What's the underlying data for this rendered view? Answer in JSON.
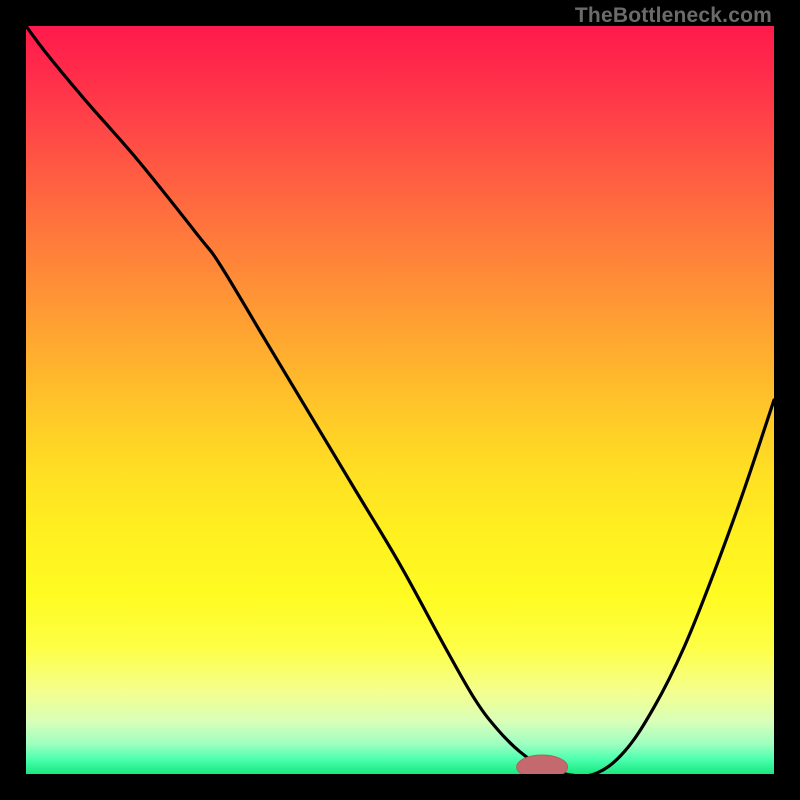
{
  "watermark": "TheBottleneck.com",
  "colors": {
    "frame": "#000000",
    "curve_stroke": "#000000",
    "marker_fill": "#c46a6f",
    "marker_stroke": "#b85c61"
  },
  "chart_data": {
    "type": "line",
    "title": "",
    "xlabel": "",
    "ylabel": "",
    "xlim": [
      0,
      100
    ],
    "ylim": [
      0,
      100
    ],
    "grid": false,
    "x": [
      0,
      3,
      8,
      15,
      23,
      26,
      32,
      38,
      44,
      50,
      56,
      60,
      63,
      66,
      69,
      72,
      76,
      80,
      84,
      88,
      92,
      96,
      100
    ],
    "values": [
      100,
      96,
      90,
      82,
      72,
      68,
      58,
      48,
      38,
      28,
      17,
      10,
      6,
      3,
      1,
      0,
      0,
      3,
      9,
      17,
      27,
      38,
      50
    ],
    "marker": {
      "x": 69,
      "y": 0,
      "rx": 3.4,
      "ry": 1.6
    }
  }
}
